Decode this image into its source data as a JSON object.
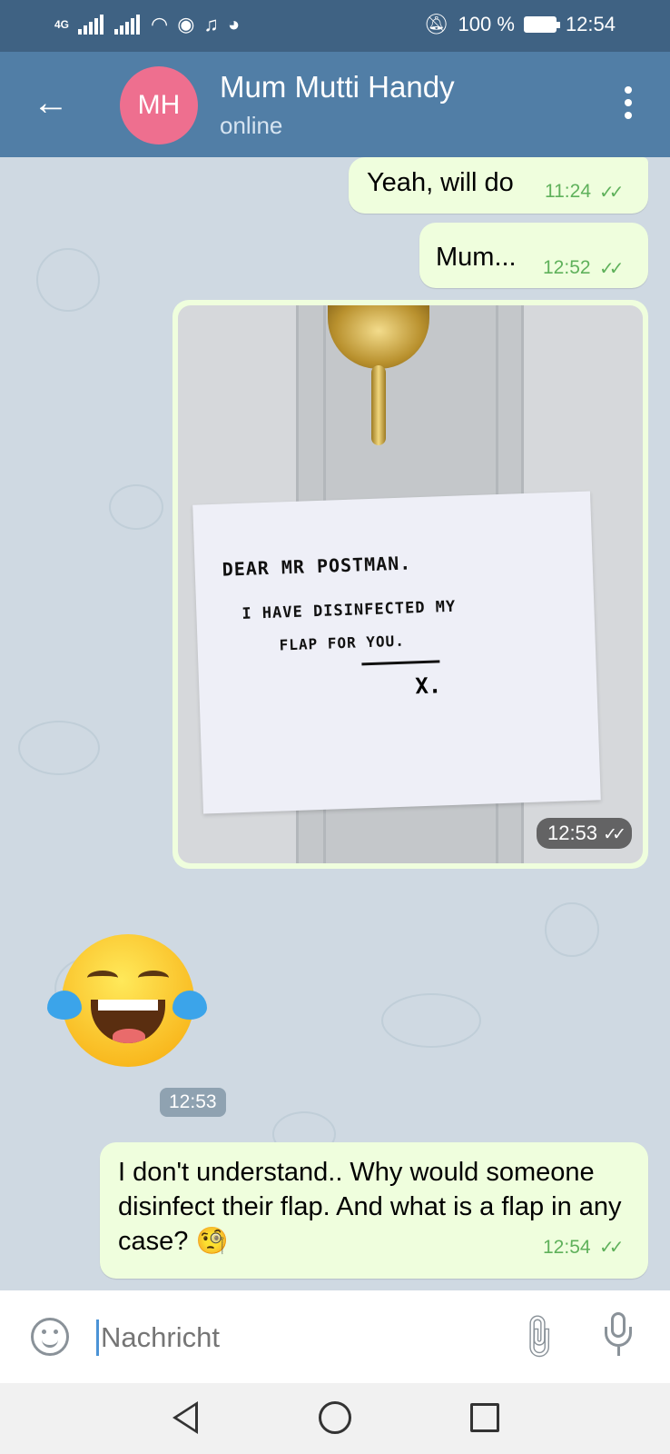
{
  "status_bar": {
    "network": "4G",
    "battery": "100 %",
    "time": "12:54"
  },
  "header": {
    "avatar_initials": "MH",
    "contact_name": "Mum Mutti Handy",
    "status": "online"
  },
  "messages": [
    {
      "type": "text",
      "direction": "out",
      "text": "Yeah, will do",
      "time": "11:24",
      "ticks": "✓✓"
    },
    {
      "type": "text",
      "direction": "out",
      "text": "Mum...",
      "time": "12:52",
      "ticks": "✓✓"
    },
    {
      "type": "photo",
      "direction": "out",
      "time": "12:53",
      "ticks": "✓✓",
      "note_lines": [
        "DEAR MR POSTMAN.",
        "I HAVE DISINFECTED MY",
        "FLAP FOR YOU.",
        "X."
      ]
    },
    {
      "type": "emoji",
      "direction": "in",
      "emoji_name": "face-with-tears-of-joy",
      "time": "12:53"
    },
    {
      "type": "text",
      "direction": "out",
      "text": "I don't understand.. Why would someone disinfect their flap. And what is a flap in any case? 🧐",
      "time": "12:54",
      "ticks": "✓✓"
    }
  ],
  "input": {
    "placeholder": "Nachricht"
  },
  "colors": {
    "header": "#517ea6",
    "status_bar": "#3f6283",
    "outgoing_bubble": "#effedd",
    "tick": "#5fb15b",
    "avatar": "#ee6f8f"
  },
  "icons": [
    "back-arrow-icon",
    "more-vertical-icon",
    "emoji-icon",
    "attach-icon",
    "mic-icon",
    "nav-back-icon",
    "nav-home-icon",
    "nav-recents-icon"
  ]
}
